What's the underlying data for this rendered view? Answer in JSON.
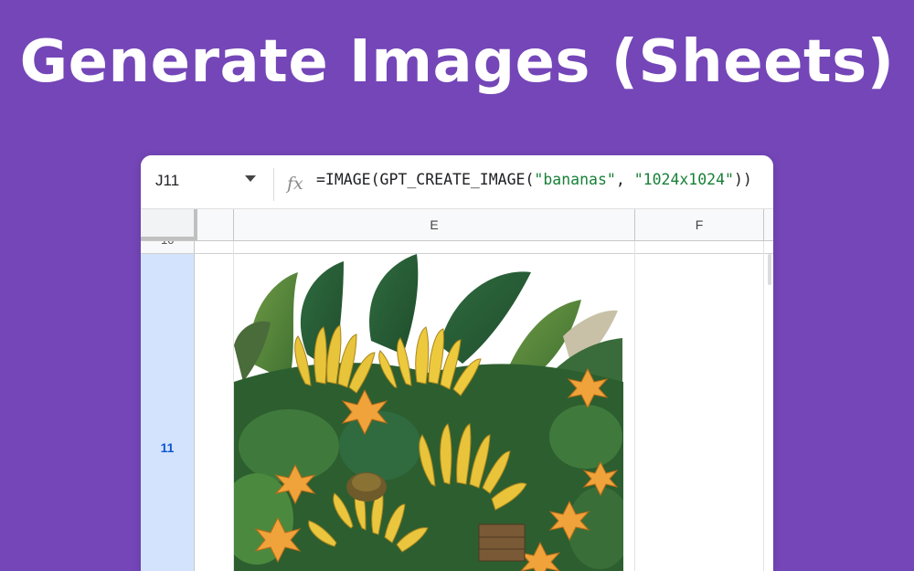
{
  "title": "Generate Images (Sheets)",
  "formula_bar": {
    "cell_ref": "J11",
    "fx_symbol": "fx",
    "formula_parts": {
      "prefix": "=IMAGE(GPT_CREATE_IMAGE(",
      "arg1": "\"bananas\"",
      "sep": ", ",
      "arg2": "\"1024x1024\"",
      "suffix": "))"
    }
  },
  "columns": [
    "E",
    "F"
  ],
  "rows": {
    "partial": "10",
    "active": "11"
  },
  "colors": {
    "background": "#7446B8",
    "active_row_header": "#d3e3fd",
    "string_literal": "#188038"
  }
}
